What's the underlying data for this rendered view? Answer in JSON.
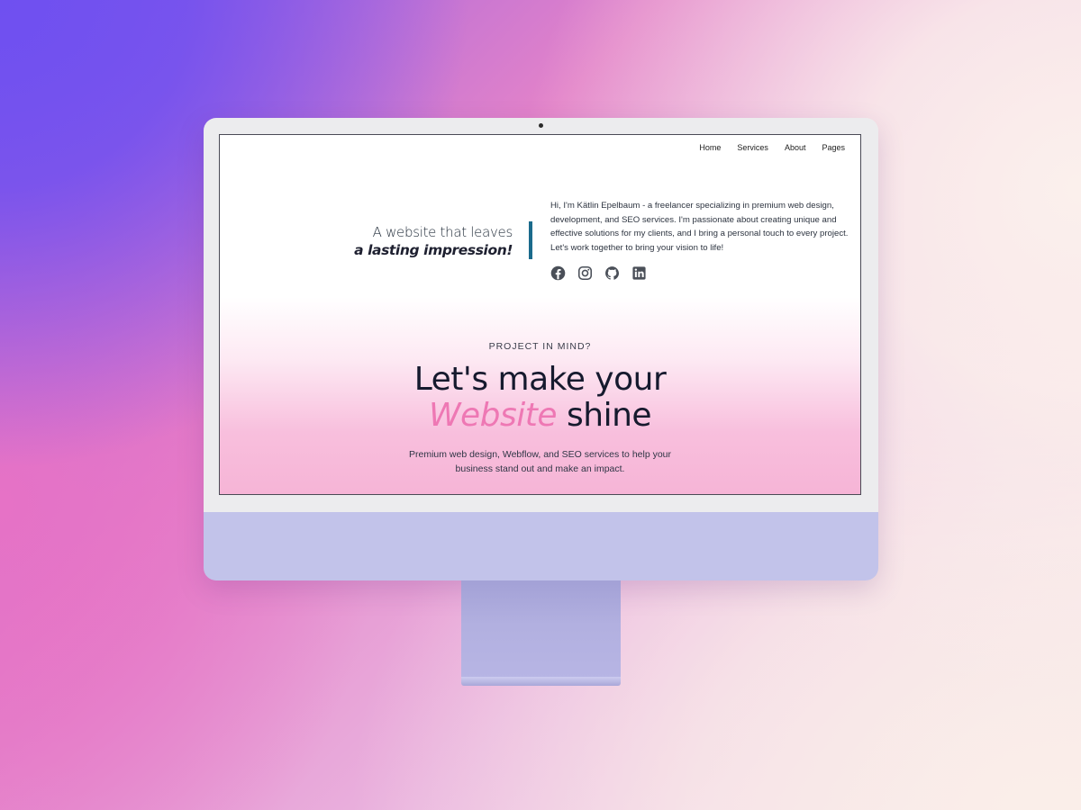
{
  "nav": {
    "items": [
      "Home",
      "Services",
      "About",
      "Pages"
    ]
  },
  "hero": {
    "tagline_line1": "A website that leaves",
    "tagline_line2": "a lasting impression!",
    "bio": "Hi, I'm Kätlin Epelbaum - a freelancer specializing in premium web design, development, and SEO services. I'm passionate about creating unique and effective solutions for my clients, and I bring a personal touch to every project. Let's work together to bring your vision to life!",
    "socials": [
      "facebook-icon",
      "instagram-icon",
      "github-icon",
      "linkedin-icon"
    ]
  },
  "cta": {
    "eyebrow": "PROJECT IN MIND?",
    "headline_line1": "Let's make your",
    "headline_accent": "Website",
    "headline_end": "shine",
    "subtext_line1": "Premium web design, Webflow, and SEO services to help your",
    "subtext_line2": "business stand out and make an impact."
  },
  "colors": {
    "accent_pink": "#ee78b4",
    "accent_bar": "#1b6b8c",
    "dark_text": "#161a2e",
    "monitor_chin": "#c2c3ea",
    "social_icon": "#4a4f58"
  }
}
